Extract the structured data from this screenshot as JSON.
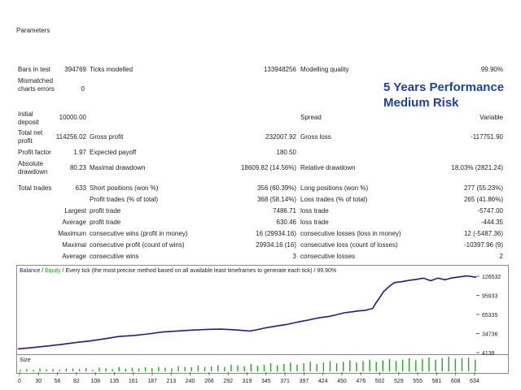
{
  "parameters_title": "Parameters",
  "promo": {
    "line1": "5 Years Performance",
    "line2": "Medium Risk",
    "color": "#1f3fb0"
  },
  "stats": {
    "bars_in_test_label": "Bars in test",
    "bars_in_test": "394769",
    "ticks_modelled_label": "Ticks modelled",
    "ticks_modelled": "133948256",
    "modelling_quality_label": "Modelling quality",
    "modelling_quality": "99.90%",
    "mismatched_label": "Mismatched charts errors",
    "mismatched": "0",
    "initial_deposit_label": "Initial deposit",
    "initial_deposit": "10000.00",
    "spread_label": "Spread",
    "spread": "Variable",
    "total_net_profit_label": "Total net profit",
    "total_net_profit": "114256.02",
    "gross_profit_label": "Gross profit",
    "gross_profit": "232007.92",
    "gross_loss_label": "Gross loss",
    "gross_loss": "-117751.90",
    "profit_factor_label": "Profit factor",
    "profit_factor": "1.97",
    "expected_payoff_label": "Expected payoff",
    "expected_payoff": "180.50",
    "absolute_drawdown_label": "Absolute drawdown",
    "absolute_drawdown": "80.23",
    "maximal_drawdown_label": "Maximal drawdown",
    "maximal_drawdown": "18609.82 (14.56%)",
    "relative_drawdown_label": "Relative drawdown",
    "relative_drawdown": "18.03% (2821.24)",
    "total_trades_label": "Total trades",
    "total_trades": "633",
    "short_positions_label": "Short positions (won %)",
    "short_positions": "356 (60.39%)",
    "long_positions_label": "Long positions (won %)",
    "long_positions": "277 (55.23%)",
    "profit_trades_label": "Profit trades (% of total)",
    "profit_trades": "368 (58.14%)",
    "loss_trades_label": "Loss trades (% of total)",
    "loss_trades": "265 (41.86%)",
    "largest_label": "Largest",
    "largest_profit_label": "profit trade",
    "largest_profit": "7486.71",
    "largest_loss_label": "loss trade",
    "largest_loss": "-5747.00",
    "average_label": "Average",
    "average_profit_label": "profit trade",
    "average_profit": "630.46",
    "average_loss_label": "loss trade",
    "average_loss": "-444.35",
    "maximum_label": "Maximum",
    "max_cons_wins_label": "consecutive wins (profit in money)",
    "max_cons_wins": "16 (29934.16)",
    "max_cons_losses_label": "consecutive losses (loss in money)",
    "max_cons_losses": "12 (-5487.36)",
    "maximal_label": "Maximal",
    "maximal_cons_profit_label": "consecutive profit (count of wins)",
    "maximal_cons_profit": "29934.16 (16)",
    "maximal_cons_loss_label": "consecutive loss (count of losses)",
    "maximal_cons_loss": "-10397.96 (9)",
    "avg_cons_label": "Average",
    "avg_cons_wins_label": "consecutive wins",
    "avg_cons_wins": "3",
    "avg_cons_losses_label": "consecutive losses",
    "avg_cons_losses": "2"
  },
  "chart_data": {
    "type": "line",
    "legend_balance": "Balance",
    "legend_sep": " / ",
    "legend_equity": "Equity",
    "legend_rest": " / Every tick (the most precise method based on all available least timeframes to generate each tick) / 99.90%",
    "size_label": "Size",
    "colors": {
      "balance": "#1a1f8c",
      "equity": "#22aa22",
      "size_bars": "#22aa22",
      "legend_balance": "#1a1f8c",
      "legend_equity": "#1a9a1a"
    },
    "ylim": [
      4138,
      126532
    ],
    "xlim": [
      0,
      633
    ],
    "y_ticks": [
      "126532",
      "95933",
      "65335",
      "34736",
      "4138"
    ],
    "x_ticks": [
      "0",
      "30",
      "56",
      "82",
      "108",
      "135",
      "161",
      "187",
      "213",
      "240",
      "266",
      "292",
      "319",
      "345",
      "371",
      "397",
      "424",
      "450",
      "476",
      "502",
      "529",
      "555",
      "581",
      "608",
      "634"
    ],
    "series": [
      {
        "name": "Balance",
        "x": [
          0,
          20,
          40,
          60,
          80,
          100,
          120,
          140,
          160,
          180,
          200,
          220,
          240,
          260,
          280,
          300,
          310,
          320,
          330,
          340,
          350,
          360,
          370,
          380,
          390,
          400,
          410,
          420,
          430,
          440,
          450,
          460,
          470,
          480,
          490,
          495,
          500,
          505,
          510,
          515,
          520,
          530,
          540,
          550,
          560,
          570,
          580,
          590,
          600,
          610,
          620,
          633
        ],
        "y": [
          10000,
          12000,
          14500,
          17000,
          20000,
          22500,
          26000,
          29500,
          31000,
          33500,
          36500,
          38000,
          39500,
          40500,
          41000,
          40000,
          39000,
          38000,
          40000,
          42500,
          44500,
          46500,
          48000,
          50500,
          53000,
          55000,
          57500,
          59500,
          61000,
          63500,
          66500,
          68000,
          69500,
          70500,
          73500,
          83000,
          91000,
          100000,
          105000,
          110000,
          114000,
          115500,
          117500,
          119000,
          121000,
          117000,
          121000,
          118500,
          121500,
          123000,
          124500,
          122500
        ]
      }
    ],
    "size_values": [
      0.1,
      0.15,
      0.1,
      0.2,
      0.12,
      0.15,
      0.1,
      0.18,
      0.2,
      0.15,
      0.22,
      0.1,
      0.25,
      0.2,
      0.15,
      0.3,
      0.18,
      0.25,
      0.2,
      0.28,
      0.22,
      0.3,
      0.25,
      0.2,
      0.35,
      0.3,
      0.28,
      0.4,
      0.3,
      0.35,
      0.42,
      0.3,
      0.45,
      0.4,
      0.35,
      0.5,
      0.38,
      0.45,
      0.55,
      0.4,
      0.5,
      0.6,
      0.45,
      0.55,
      0.65,
      0.5,
      0.6,
      0.7,
      0.55,
      0.65,
      0.75,
      0.6,
      0.7,
      0.8,
      0.65,
      0.75,
      0.85,
      0.7,
      0.8,
      0.9,
      0.75,
      0.85,
      0.95,
      0.8,
      0.9,
      1.0,
      0.85,
      0.9,
      0.95,
      0.8
    ]
  }
}
